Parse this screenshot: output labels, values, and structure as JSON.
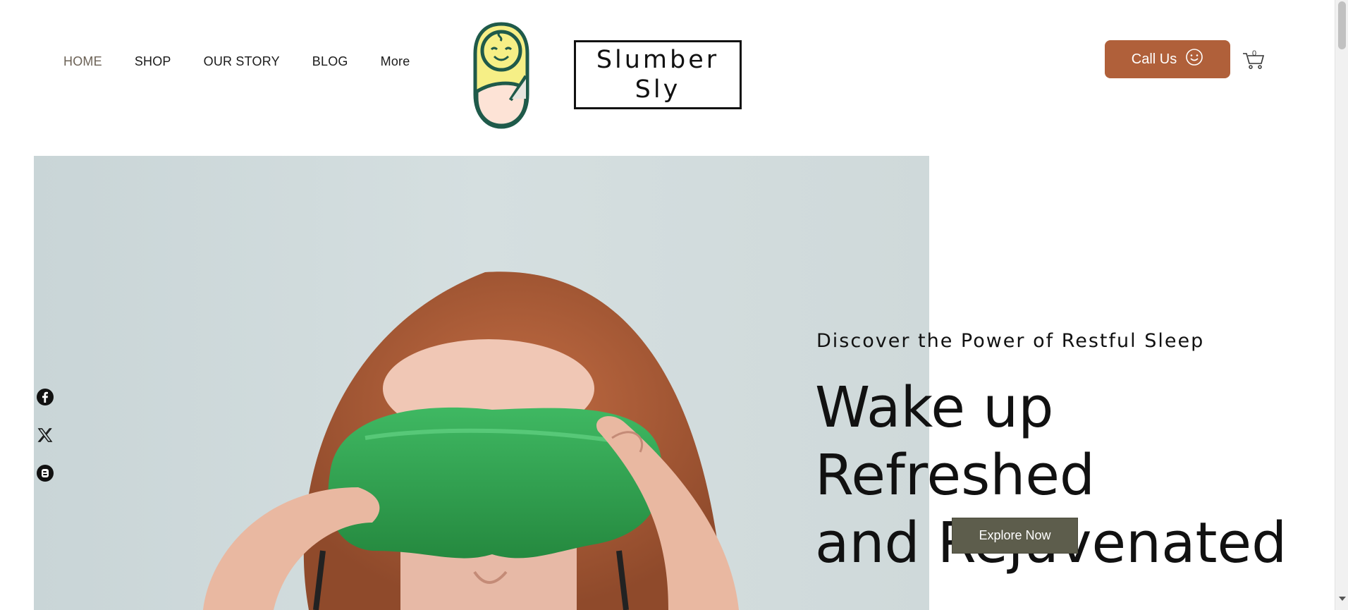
{
  "nav": {
    "items": [
      {
        "label": "HOME",
        "active": true
      },
      {
        "label": "SHOP"
      },
      {
        "label": "OUR STORY"
      },
      {
        "label": "BLOG"
      },
      {
        "label": "More"
      }
    ]
  },
  "brand": {
    "line1": "Slumber",
    "line2": "Sly",
    "logo_icon": "swaddled-baby-icon"
  },
  "header": {
    "call_label": "Call Us",
    "call_icon": "smiley-icon",
    "cart_icon": "cart-icon",
    "cart_count": "0"
  },
  "hero": {
    "kicker": "Discover the Power of Restful Sleep",
    "headline_line1": "Wake up Refreshed",
    "headline_line2": "and Rejuvenated",
    "cta_label": "Explore Now",
    "image_alt": "woman-with-green-sleep-mask"
  },
  "social": [
    "facebook-icon",
    "x-icon",
    "blogger-icon"
  ],
  "colors": {
    "accent": "#b0603a",
    "cta": "#5d5d4c",
    "nav_active": "#6b6155",
    "mask_green": "#2f9e4f",
    "logo_green": "#1f5a4a",
    "logo_yellow": "#f6ef86"
  }
}
